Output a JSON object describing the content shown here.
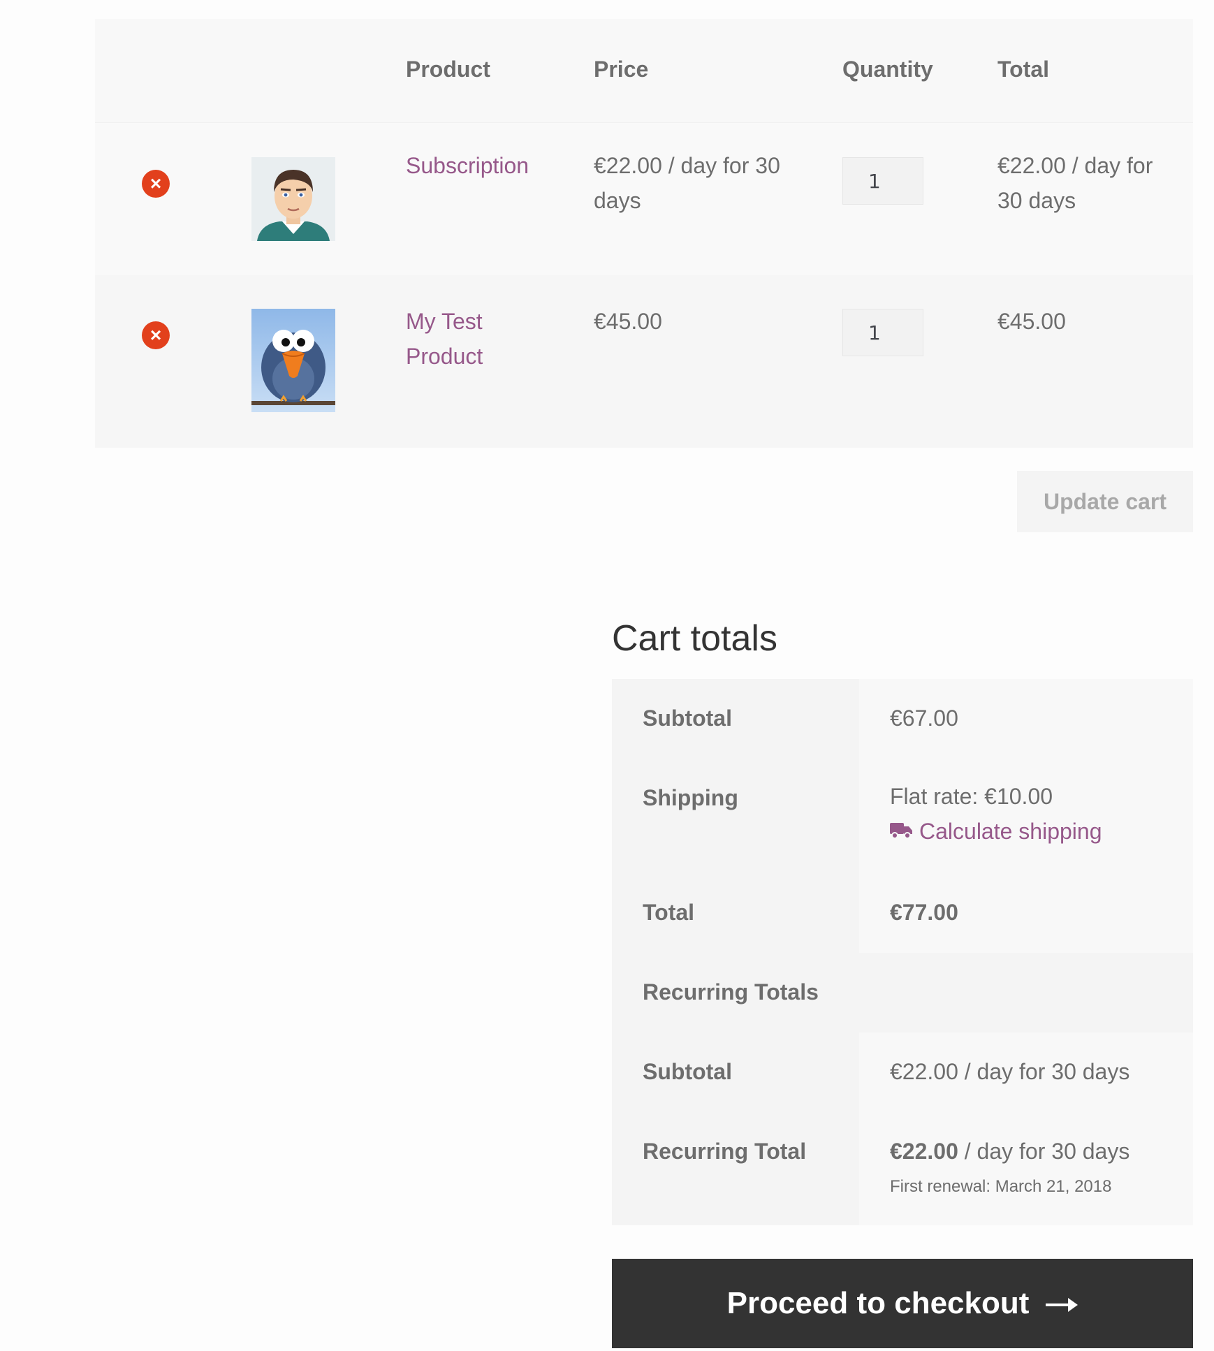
{
  "table": {
    "headers": {
      "product": "Product",
      "price": "Price",
      "quantity": "Quantity",
      "total": "Total"
    },
    "rows": [
      {
        "name": "Subscription",
        "price_line1": "€22.00 / day for 30",
        "price_line2": "days",
        "quantity": "1",
        "total_line1": "€22.00 / day for",
        "total_line2": "30 days",
        "thumbnail": "avatar-man-icon"
      },
      {
        "name_line1": "My Test",
        "name_line2": "Product",
        "price": "€45.00",
        "quantity": "1",
        "total": "€45.00",
        "thumbnail": "cartoon-bird-icon"
      }
    ]
  },
  "update_cart_label": "Update cart",
  "totals": {
    "title": "Cart totals",
    "subtotal_label": "Subtotal",
    "subtotal_value": "€67.00",
    "shipping_label": "Shipping",
    "shipping_value": "Flat rate: €10.00",
    "calculate_shipping": "Calculate shipping",
    "total_label": "Total",
    "total_value": "€77.00",
    "recurring_totals_label": "Recurring Totals",
    "recurring_subtotal_label": "Subtotal",
    "recurring_subtotal_value": "€22.00 / day for 30 days",
    "recurring_total_label": "Recurring Total",
    "recurring_total_amount": "€22.00",
    "recurring_total_period": " / day for 30 days",
    "first_renewal": "First renewal: March 21, 2018"
  },
  "checkout_label": "Proceed to checkout",
  "colors": {
    "accent": "#96588a",
    "remove": "#e2401c",
    "checkout_bg": "#333333"
  }
}
